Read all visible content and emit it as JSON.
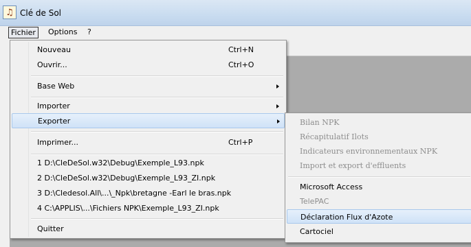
{
  "window": {
    "title": "Clé de Sol",
    "icon": "clef-app-icon"
  },
  "menubar": {
    "items": [
      "Fichier",
      "Options",
      "?"
    ]
  },
  "file_menu": {
    "items": [
      {
        "label": "Nouveau",
        "shortcut": "Ctrl+N"
      },
      {
        "label": "Ouvrir...",
        "shortcut": "Ctrl+O"
      },
      {
        "label": "Base Web",
        "submenu": true
      },
      {
        "label": "Importer",
        "submenu": true
      },
      {
        "label": "Exporter",
        "submenu": true,
        "highlighted": true
      },
      {
        "label": "Imprimer...",
        "shortcut": "Ctrl+P"
      },
      {
        "label": "1 D:\\CleDeSol.w32\\Debug\\Exemple_L93.npk"
      },
      {
        "label": "2 D:\\CleDeSol.w32\\Debug\\Exemple_L93_ZI.npk"
      },
      {
        "label": "3 D:\\Cledesol.All\\...\\_Npk\\bretagne -Earl le bras.npk"
      },
      {
        "label": "4 C:\\APPLIS\\...\\Fichiers NPK\\Exemple_L93_ZI.npk"
      },
      {
        "label": "Quitter"
      }
    ]
  },
  "export_submenu": {
    "items": [
      {
        "label": "Bilan NPK",
        "disabled": true
      },
      {
        "label": "Récapitulatif Ilots",
        "disabled": true
      },
      {
        "label": "Indicateurs environnementaux NPK",
        "disabled": true
      },
      {
        "label": "Import et export d'effluents",
        "disabled": true
      },
      {
        "label": "Microsoft Access",
        "disabled": false
      },
      {
        "label": "TelePAC",
        "disabled": true
      },
      {
        "label": "Déclaration Flux d'Azote",
        "disabled": false,
        "highlighted": true
      },
      {
        "label": "Cartociel",
        "disabled": false
      }
    ]
  },
  "colors": {
    "highlight_bg": "#cfe2f7",
    "highlight_border": "#a8c8ec",
    "disabled_text": "#8d8d8d",
    "workspace": "#ababab"
  }
}
